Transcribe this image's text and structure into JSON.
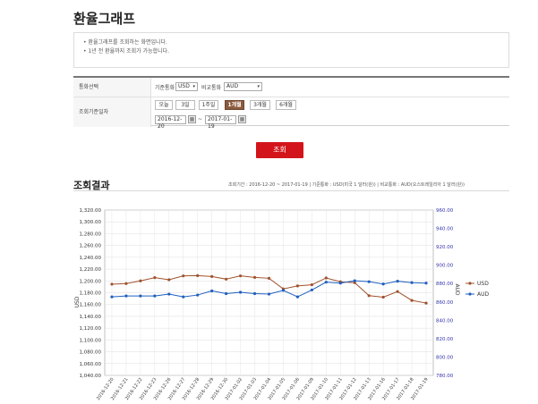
{
  "page": {
    "title": "환율그래프",
    "notice": [
      "• 환율그래프를 조회하는 화면입니다.",
      "• 1년 전 환율까지 조회가 가능합니다."
    ]
  },
  "form": {
    "currency_label": "통화선택",
    "base_currency_label": "기준통화",
    "base_currency_value": "USD",
    "compare_currency_label": "비교통화",
    "compare_currency_value": "AUD",
    "period_label": "조회기준일자",
    "period_buttons": [
      "오늘",
      "3일",
      "1주일",
      "1개월",
      "3개월",
      "6개월"
    ],
    "active_period": "1개월",
    "start_date": "2016-12-20",
    "end_date": "2017-01-19",
    "date_separator": "~",
    "search_button": "조회"
  },
  "result": {
    "title": "조회결과",
    "info": "조회기간 : 2016-12-20 ~ 2017-01-19 | 기준통화 : USD(미국 1 달러(원)) | 비교통화 : AUD(오스트레일리아 1 달러(원))"
  },
  "chart_data": {
    "type": "line",
    "x": [
      "2016-12-20",
      "2016-12-21",
      "2016-12-22",
      "2016-12-23",
      "2016-12-26",
      "2016-12-27",
      "2016-12-28",
      "2016-12-29",
      "2016-12-30",
      "2017-01-02",
      "2017-01-03",
      "2017-01-04",
      "2017-01-05",
      "2017-01-06",
      "2017-01-09",
      "2017-01-10",
      "2017-01-11",
      "2017-01-12",
      "2017-01-13",
      "2017-01-16",
      "2017-01-17",
      "2017-01-18",
      "2017-01-19"
    ],
    "series": [
      {
        "name": "USD",
        "axis": "left",
        "color": "#a0522d",
        "values": [
          1194.5,
          1195.5,
          1200.0,
          1205.5,
          1202.0,
          1208.5,
          1209.0,
          1207.5,
          1203.0,
          1208.5,
          1206.0,
          1204.5,
          1186.5,
          1191.5,
          1193.5,
          1205.0,
          1198.5,
          1197.0,
          1175.0,
          1172.5,
          1182.0,
          1167.0,
          1162.5,
          1174.5
        ]
      },
      {
        "name": "AUD",
        "axis": "right",
        "color": "#1f5fbf",
        "values": [
          865.5,
          866.5,
          866.5,
          866.5,
          868.5,
          865.5,
          867.5,
          872.0,
          869.0,
          870.5,
          869.0,
          868.5,
          872.5,
          865.5,
          873.0,
          881.5,
          880.5,
          883.0,
          882.0,
          879.5,
          882.5,
          881.0,
          880.5,
          885.0
        ]
      }
    ],
    "ylabel_left": "USD",
    "ylabel_right": "AUD",
    "yleft_ticks": [
      "1,320.00",
      "1,300.00",
      "1,280.00",
      "1,260.00",
      "1,240.00",
      "1,220.00",
      "1,200.00",
      "1,180.00",
      "1,160.00",
      "1,140.00",
      "1,120.00",
      "1,100.00",
      "1,080.00",
      "1,060.00",
      "1,040.00"
    ],
    "yright_ticks": [
      "960.00",
      "940.00",
      "920.00",
      "900.00",
      "880.00",
      "860.00",
      "840.00",
      "820.00",
      "800.00",
      "780.00"
    ],
    "yleft_range": [
      1040,
      1320
    ],
    "yright_range": [
      780,
      960
    ],
    "grid": true,
    "legend_position": "right"
  }
}
